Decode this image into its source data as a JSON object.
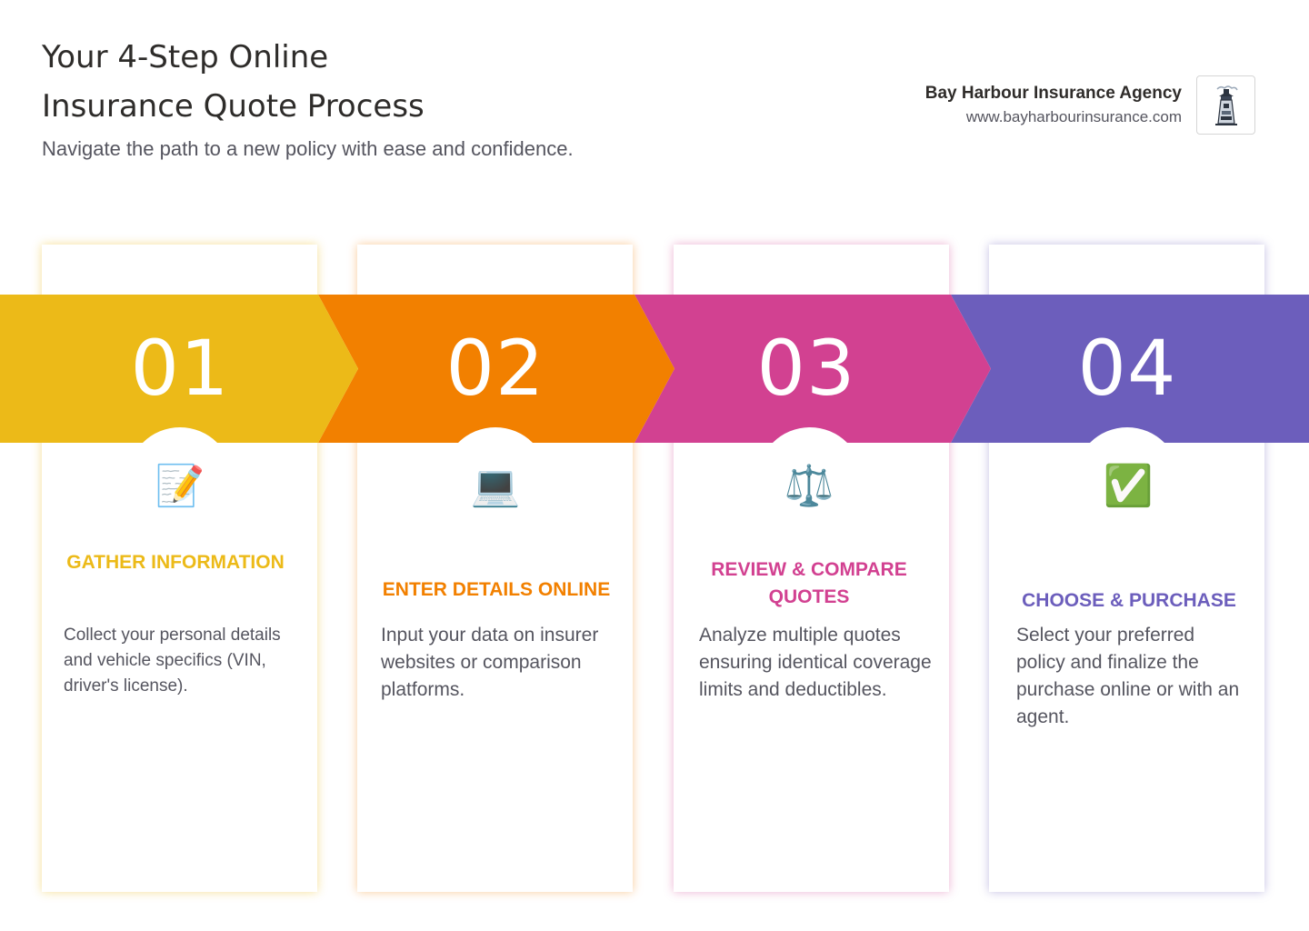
{
  "header": {
    "title_line1": "Your 4-Step Online",
    "title_line2": "Insurance Quote Process",
    "subtitle": "Navigate the path to a new policy with ease and confidence."
  },
  "brand": {
    "name": "Bay Harbour Insurance Agency",
    "url": "www.bayharbourinsurance.com",
    "logo_icon": "lighthouse-icon"
  },
  "colors": {
    "step1": "#ECBA18",
    "step2": "#F28000",
    "step3": "#D24191",
    "step4": "#6C5EBC"
  },
  "steps": [
    {
      "number": "01",
      "icon": "📝",
      "icon_name": "memo-pencil-icon",
      "title": "GATHER INFORMATION",
      "description": "Collect your personal details and vehicle specifics (VIN, driver's license)."
    },
    {
      "number": "02",
      "icon": "💻",
      "icon_name": "laptop-icon",
      "title": "ENTER DETAILS ONLINE",
      "description": "Input your data on insurer websites or comparison platforms."
    },
    {
      "number": "03",
      "icon": "⚖️",
      "icon_name": "balance-scale-icon",
      "title": "REVIEW & COMPARE QUOTES",
      "description": "Analyze multiple quotes ensuring identical coverage limits and deductibles."
    },
    {
      "number": "04",
      "icon": "✅",
      "icon_name": "check-mark-icon",
      "title": "CHOOSE & PURCHASE",
      "description": "Select your preferred policy and finalize the purchase online or with an agent."
    }
  ]
}
